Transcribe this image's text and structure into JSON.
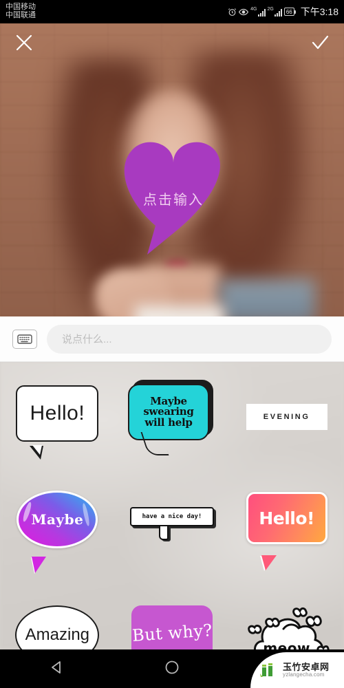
{
  "status_bar": {
    "carriers": [
      "中国移动",
      "中国联通"
    ],
    "icons": [
      "alarm-icon",
      "eye-icon",
      "signal-4g-icon",
      "signal-2g-icon",
      "battery-icon"
    ],
    "network_labels": [
      "4G",
      "2G"
    ],
    "battery_level": "66",
    "time": "下午3:18"
  },
  "editor_toolbar": {
    "close_label": "close-icon",
    "confirm_label": "check-icon"
  },
  "canvas": {
    "sticker": {
      "shape": "heart",
      "color": "#a83ac0",
      "placeholder": "点击输入"
    }
  },
  "input_bar": {
    "keyboard_icon": "keyboard-icon",
    "placeholder": "说点什么...",
    "value": ""
  },
  "sticker_panel": {
    "background_color": "#d6d2ce",
    "stickers": [
      {
        "id": "hello-outline",
        "text": "Hello!",
        "style": "white-outline-bubble",
        "color": "#ffffff"
      },
      {
        "id": "maybe-swearing",
        "text": "Maybe\nswearing\nwill help",
        "style": "cyan-bubble",
        "color": "#24d3d8"
      },
      {
        "id": "evening",
        "text": "EVENING",
        "style": "white-rect",
        "color": "#ffffff"
      },
      {
        "id": "maybe-gradient",
        "text": "Maybe",
        "style": "gradient-oval-bubble",
        "color": "#b43ae0"
      },
      {
        "id": "nice-day-pixel",
        "text": "have a nice day!",
        "style": "pixel-bubble",
        "color": "#ffffff"
      },
      {
        "id": "hello-gradient",
        "text": "Hello!",
        "style": "gradient-rect-bubble",
        "color": "#ff6a72"
      },
      {
        "id": "amazing",
        "text": "Amazing",
        "style": "white-oval-bubble",
        "color": "#ffffff"
      },
      {
        "id": "but-why",
        "text": "But why?",
        "style": "purple-bubble",
        "color": "#c657d0"
      },
      {
        "id": "meow-cloud",
        "text": "meow",
        "style": "cloud-bubble-hearts",
        "color": "#ffffff"
      }
    ],
    "sticker_lines": {
      "maybe_swearing_l1": "Maybe",
      "maybe_swearing_l2": "swearing",
      "maybe_swearing_l3": "will help"
    }
  },
  "nav_bar": {
    "back": "back-triangle-icon",
    "home": "home-circle-icon",
    "recents": "recents-square-icon"
  },
  "watermark": {
    "cn": "玉竹安卓网",
    "en": "yzlangecha.com"
  }
}
